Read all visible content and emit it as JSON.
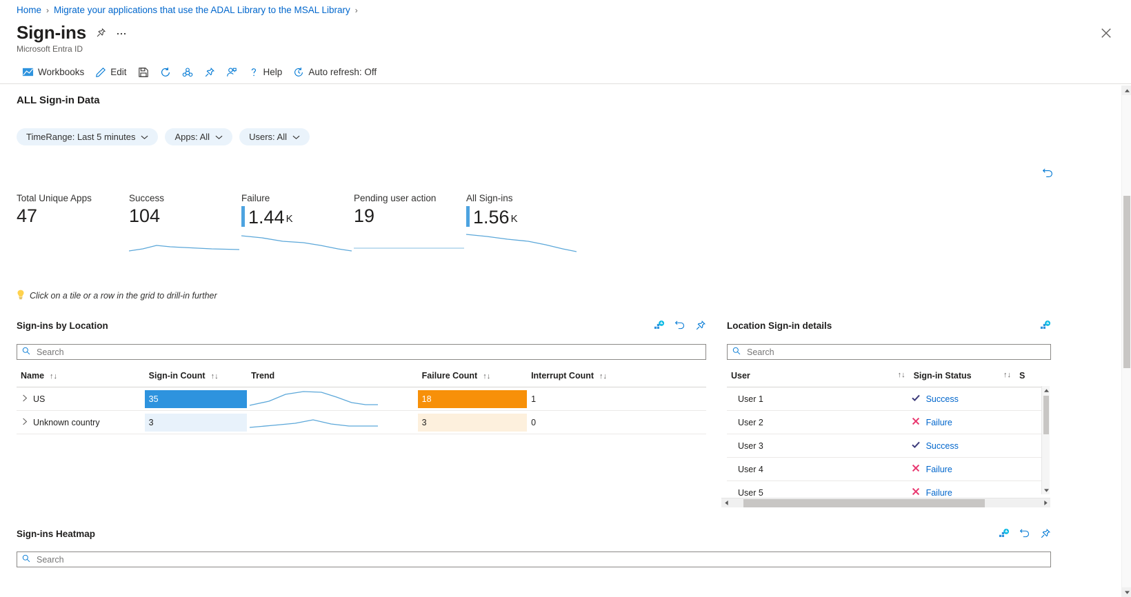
{
  "breadcrumb": {
    "items": [
      {
        "label": "Home"
      },
      {
        "label": "Migrate your applications that use the ADAL Library to the MSAL Library"
      }
    ],
    "separator": "›"
  },
  "header": {
    "title": "Sign-ins",
    "subtitle": "Microsoft Entra ID",
    "pin_icon": "pin-icon",
    "more_icon": "ellipsis-icon",
    "close_icon": "close-icon"
  },
  "commandbar": {
    "items": [
      {
        "label": "Workbooks",
        "icon": "workbooks-icon"
      },
      {
        "label": "Edit",
        "icon": "pencil-icon"
      },
      {
        "label": "",
        "icon": "save-icon"
      },
      {
        "label": "",
        "icon": "refresh-icon"
      },
      {
        "label": "",
        "icon": "share-icon"
      },
      {
        "label": "",
        "icon": "pin-icon"
      },
      {
        "label": "",
        "icon": "add-user-icon"
      },
      {
        "label": "Help",
        "icon": "question-icon"
      },
      {
        "label": "Auto refresh: Off",
        "icon": "clock-icon"
      }
    ]
  },
  "section": {
    "title": "ALL Sign-in Data"
  },
  "filters": [
    {
      "label": "TimeRange: Last 5 minutes",
      "value": "Last 5 minutes"
    },
    {
      "label": "Apps: All",
      "value": "All"
    },
    {
      "label": "Users: All",
      "value": "All"
    }
  ],
  "tiles_refresh_icon": "undo-icon",
  "tiles": [
    {
      "label": "Total Unique Apps",
      "value": "47",
      "unit": "",
      "bar": false
    },
    {
      "label": "Success",
      "value": "104",
      "unit": "",
      "bar": false
    },
    {
      "label": "Failure",
      "value": "1.44",
      "unit": "K",
      "bar": true
    },
    {
      "label": "Pending user action",
      "value": "19",
      "unit": "",
      "bar": false
    },
    {
      "label": "All Sign-ins",
      "value": "1.56",
      "unit": "K",
      "bar": true
    }
  ],
  "hint": {
    "icon": "lightbulb-icon",
    "text": "Click on a tile or a row in the grid to drill-in further"
  },
  "locations_panel": {
    "title": "Sign-ins by Location",
    "icons": [
      "chart-icon",
      "undo-icon",
      "pin-icon"
    ],
    "search_placeholder": "Search",
    "search_value": "",
    "columns": [
      {
        "label": "Name",
        "sortable": true
      },
      {
        "label": "Sign-in Count",
        "sortable": true
      },
      {
        "label": "Trend",
        "sortable": false
      },
      {
        "label": "Failure Count",
        "sortable": true
      },
      {
        "label": "Interrupt Count",
        "sortable": true
      }
    ],
    "sort_glyph": "↑↓",
    "rows": [
      {
        "name": "US",
        "signin_count": "35",
        "signin_pct": 100,
        "failure_count": "18",
        "failure_pct": 100,
        "interrupt_count": "1",
        "highlight": "strong"
      },
      {
        "name": "Unknown country",
        "signin_count": "3",
        "signin_pct": 100,
        "failure_count": "3",
        "failure_pct": 100,
        "interrupt_count": "0",
        "highlight": "light"
      }
    ]
  },
  "details_panel": {
    "title": "Location Sign-in details",
    "icons": [
      "chart-icon"
    ],
    "search_placeholder": "Search",
    "search_value": "",
    "columns": [
      {
        "label": "User",
        "sortable": true
      },
      {
        "label": "Sign-in Status",
        "sortable": true
      },
      {
        "label": "S",
        "sortable": false
      }
    ],
    "sort_glyph": "↑↓",
    "rows": [
      {
        "user": "User 1",
        "status": "Success",
        "status_icon": "check-icon"
      },
      {
        "user": "User 2",
        "status": "Failure",
        "status_icon": "cross-icon"
      },
      {
        "user": "User 3",
        "status": "Success",
        "status_icon": "check-icon"
      },
      {
        "user": "User 4",
        "status": "Failure",
        "status_icon": "cross-icon"
      },
      {
        "user": "User 5",
        "status": "Failure",
        "status_icon": "cross-icon"
      }
    ]
  },
  "heatmap_panel": {
    "title": "Sign-ins Heatmap",
    "icons": [
      "chart-icon",
      "undo-icon",
      "pin-icon"
    ],
    "search_placeholder": "Search",
    "search_value": ""
  },
  "colors": {
    "link": "#0066cc",
    "accent": "#0078d4",
    "bar_blue": "#2e93de",
    "bar_blue_light": "#e8f2fb",
    "bar_orange": "#f79009",
    "bar_orange_light": "#fdf0dd",
    "sparkline": "#5ba7d9",
    "success_check": "#3b3a7a",
    "failure_cross": "#e8366e",
    "pill_bg": "#eaf3fb"
  },
  "chart_data": [
    {
      "type": "line",
      "title": "Success sparkline",
      "x": [
        0,
        1,
        2,
        3,
        4,
        5,
        6,
        7,
        8
      ],
      "values": [
        2,
        4,
        9,
        7,
        6,
        5,
        5,
        4,
        4
      ],
      "xlabel": "",
      "ylabel": "",
      "grid": false
    },
    {
      "type": "line",
      "title": "Failure sparkline",
      "x": [
        0,
        1,
        2,
        3,
        4,
        5,
        6,
        7,
        8
      ],
      "values": [
        22,
        19,
        16,
        14,
        12,
        9,
        5,
        3,
        2
      ],
      "xlabel": "",
      "ylabel": "",
      "grid": false
    },
    {
      "type": "line",
      "title": "Pending user action sparkline",
      "x": [
        0,
        1,
        2,
        3,
        4,
        5,
        6,
        7,
        8
      ],
      "values": [
        3,
        3,
        3,
        3,
        3,
        3,
        3,
        3,
        3
      ],
      "xlabel": "",
      "ylabel": "",
      "grid": false
    },
    {
      "type": "line",
      "title": "All Sign-ins sparkline",
      "x": [
        0,
        1,
        2,
        3,
        4,
        5,
        6,
        7,
        8
      ],
      "values": [
        24,
        21,
        19,
        17,
        15,
        12,
        7,
        4,
        2
      ],
      "xlabel": "",
      "ylabel": "",
      "grid": false
    },
    {
      "type": "line",
      "title": "US trend",
      "x": [
        0,
        1,
        2,
        3,
        4,
        5,
        6,
        7,
        8
      ],
      "values": [
        2,
        6,
        11,
        12,
        11,
        8,
        4,
        2,
        2
      ],
      "xlabel": "",
      "ylabel": "",
      "grid": false
    },
    {
      "type": "line",
      "title": "Unknown country trend",
      "x": [
        0,
        1,
        2,
        3,
        4,
        5,
        6,
        7,
        8
      ],
      "values": [
        2,
        3,
        4,
        6,
        4,
        3,
        3,
        3,
        3
      ],
      "xlabel": "",
      "ylabel": "",
      "grid": false
    }
  ]
}
